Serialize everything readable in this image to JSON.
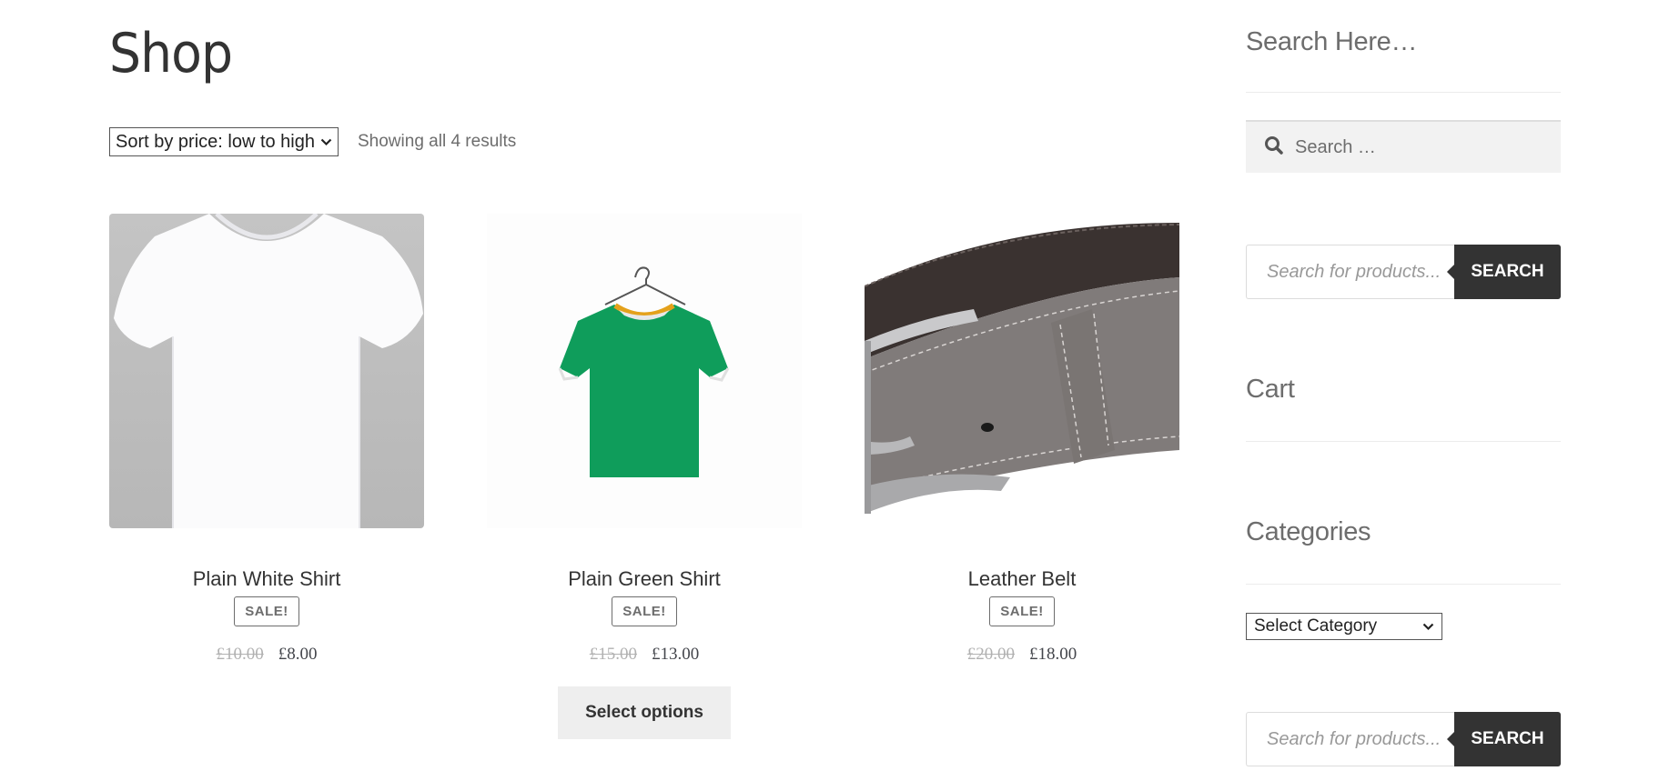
{
  "page": {
    "title": "Shop",
    "sort": {
      "selected": "Sort by price: low to high",
      "chevron": "⌄"
    },
    "result_count": "Showing all 4 results"
  },
  "products": [
    {
      "name": "Plain White Shirt",
      "badge": "SALE!",
      "old_price": "£10.00",
      "price": "£8.00",
      "image": "white-tshirt-image"
    },
    {
      "name": "Plain Green Shirt",
      "badge": "SALE!",
      "old_price": "£15.00",
      "price": "£13.00",
      "image": "green-tshirt-on-hanger-image",
      "button": "Select options"
    },
    {
      "name": "Leather Belt",
      "badge": "SALE!",
      "old_price": "£20.00",
      "price": "£18.00",
      "image": "grey-leather-belt-image"
    }
  ],
  "sidebar": {
    "search_heading": "Search Here…",
    "search_placeholder": "Search …",
    "product_search_placeholder": "Search for products...",
    "product_search_button": "SEARCH",
    "cart_heading": "Cart",
    "categories_heading": "Categories",
    "category_select": "Select Category",
    "product_search2_placeholder": "Search for products...",
    "product_search2_button": "SEARCH"
  },
  "colors": {
    "button_dark": "#333333",
    "sale_border": "#6d6d6d",
    "old_price": "#b1b1b1",
    "select_options_bg": "#eeeeee"
  }
}
